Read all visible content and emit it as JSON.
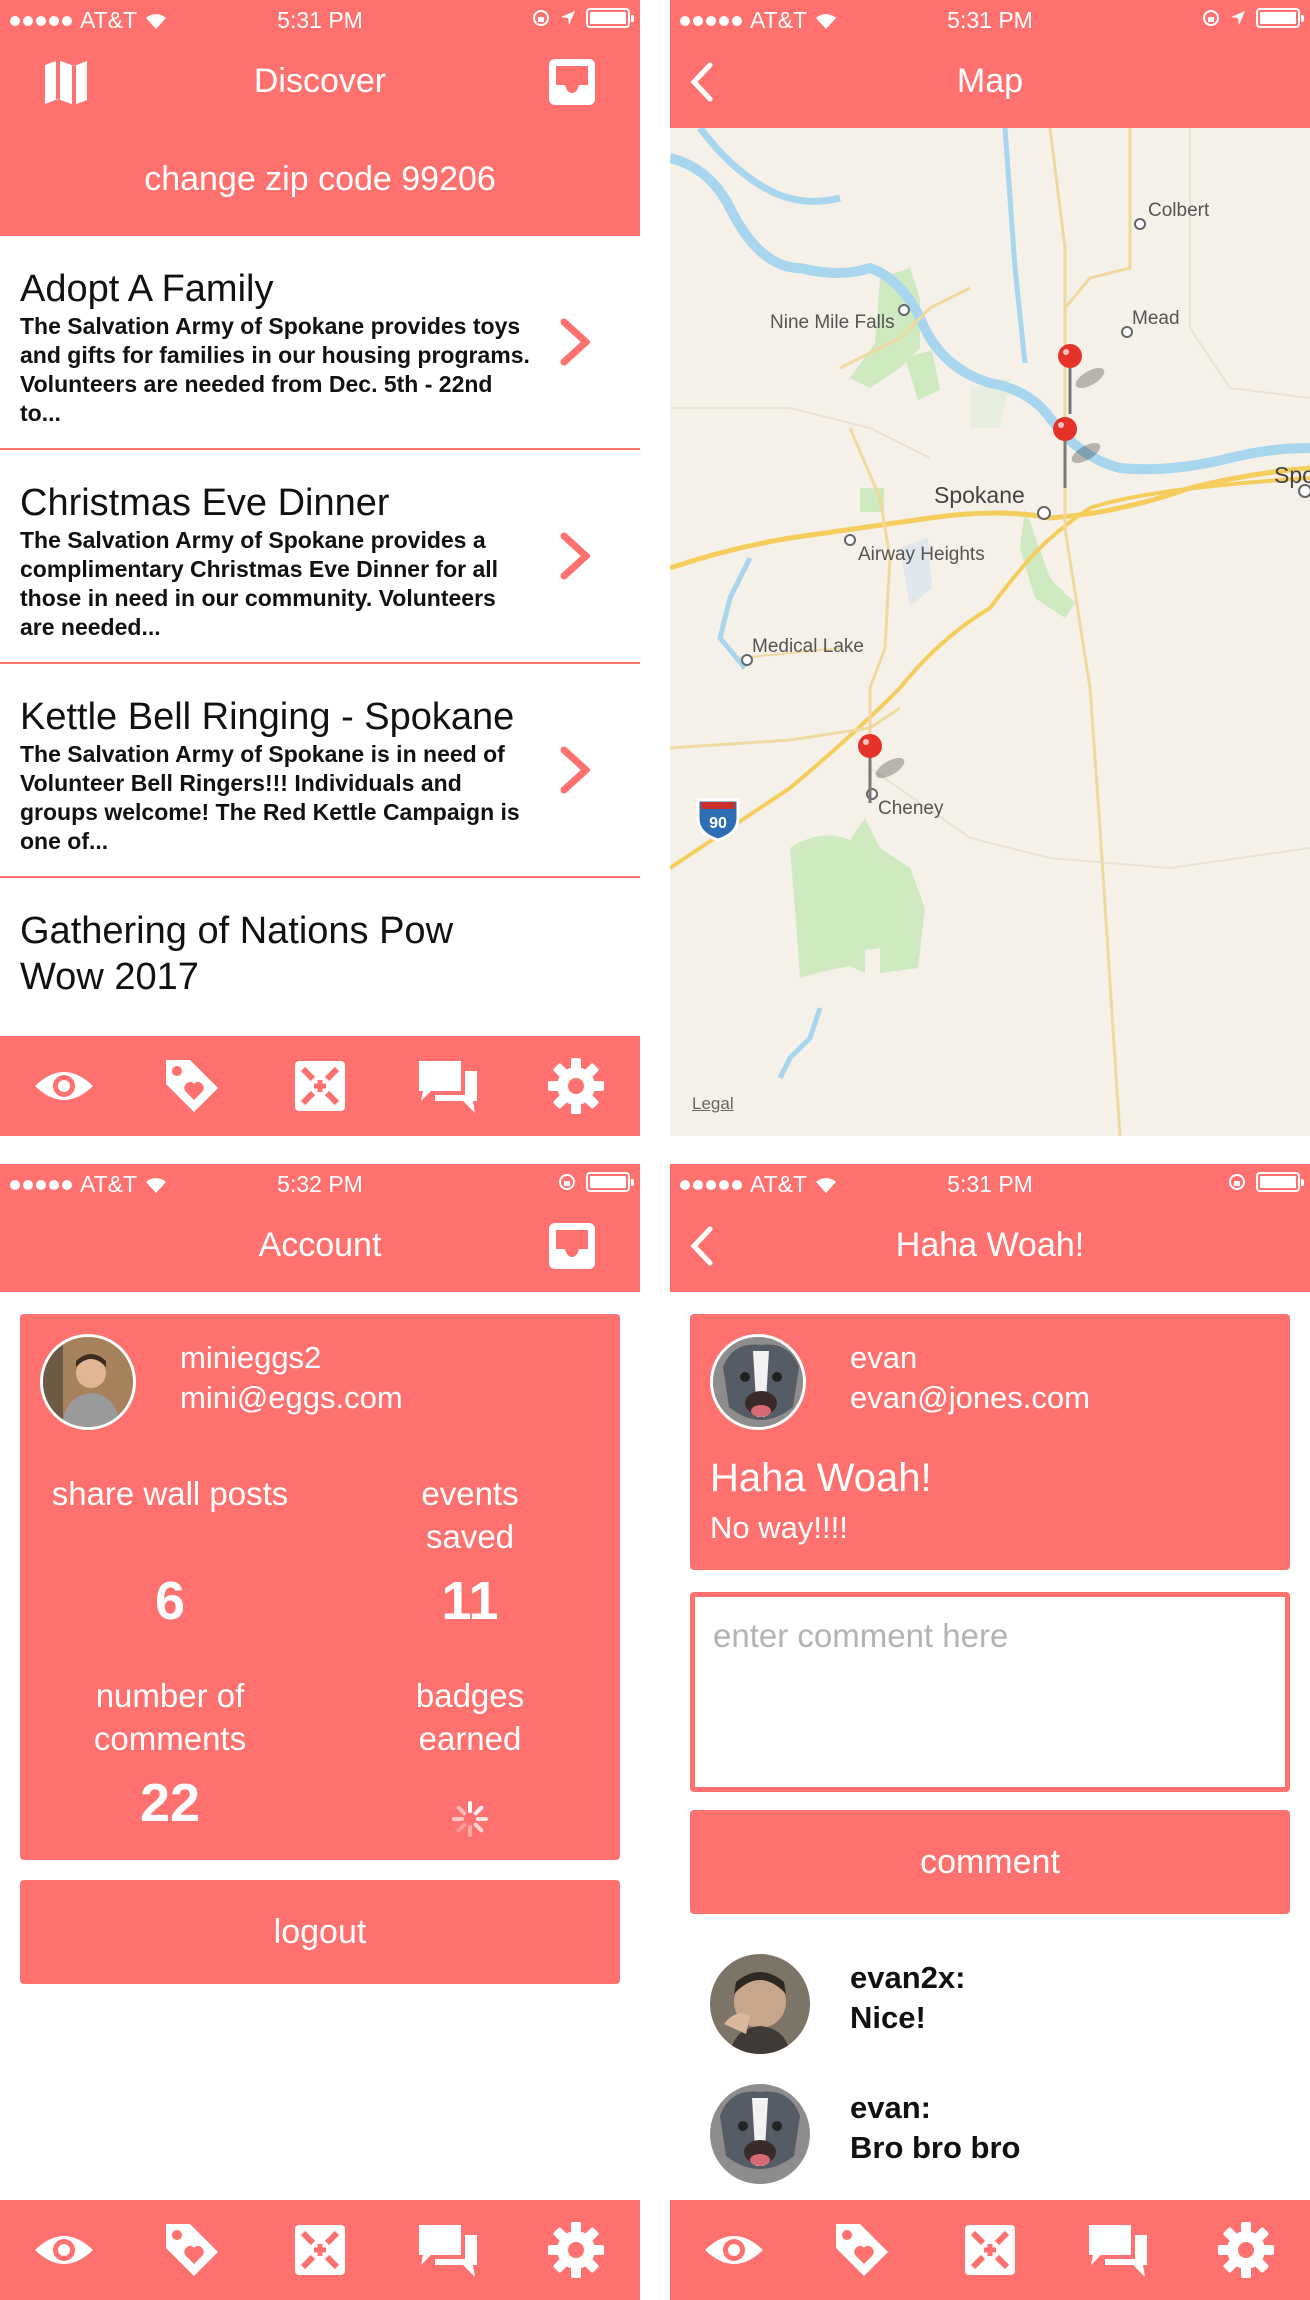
{
  "status_bar": {
    "carrier": "AT&T",
    "times": [
      "5:31 PM",
      "5:31 PM",
      "5:32 PM",
      "5:31 PM"
    ]
  },
  "colors": {
    "accent": "#ff716e",
    "text": "#111111",
    "placeholder": "#b3b3b3"
  },
  "tabbar": {
    "icons": [
      "eye-icon",
      "tag-heart-icon",
      "expand-icon",
      "chat-icon",
      "gear-icon"
    ]
  },
  "discover": {
    "title": "Discover",
    "zip_label": "change zip code 99206",
    "items": [
      {
        "title": "Adopt A Family",
        "description": "The Salvation Army of Spokane provides toys and gifts for families in our housing programs. Volunteers are needed from Dec. 5th - 22nd to..."
      },
      {
        "title": "Christmas Eve Dinner",
        "description": "The Salvation Army of Spokane provides a complimentary Christmas Eve Dinner for all those in need in our community. Volunteers are needed..."
      },
      {
        "title": "Kettle Bell Ringing - Spokane",
        "description": "The Salvation Army of Spokane is in need of Volunteer Bell Ringers!!! Individuals and groups welcome! The Red Kettle Campaign is one of..."
      },
      {
        "title": "Gathering of Nations Pow Wow 2017",
        "description": ""
      }
    ]
  },
  "map": {
    "title": "Map",
    "places": [
      "Colbert",
      "Mead",
      "Nine Mile Falls",
      "Spokane",
      "Spo",
      "Airway Heights",
      "Medical Lake",
      "Cheney"
    ],
    "highway": "90",
    "legal": "Legal"
  },
  "account": {
    "title": "Account",
    "username": "minieggs2",
    "email": "mini@eggs.com",
    "stats": [
      {
        "label": "share wall posts",
        "value": "6"
      },
      {
        "label": "events saved",
        "value": "11"
      },
      {
        "label": "number of comments",
        "value": "22"
      },
      {
        "label": "badges earned",
        "value": ""
      }
    ],
    "logout_label": "logout"
  },
  "post": {
    "title": "Haha Woah!",
    "author": "evan",
    "email": "evan@jones.com",
    "post_title": "Haha Woah!",
    "post_body": "No way!!!!",
    "comment_placeholder": "enter comment here",
    "comment_button": "comment",
    "comments": [
      {
        "user": "evan2x:",
        "text": "Nice!"
      },
      {
        "user": "evan:",
        "text": "Bro bro bro"
      }
    ]
  }
}
